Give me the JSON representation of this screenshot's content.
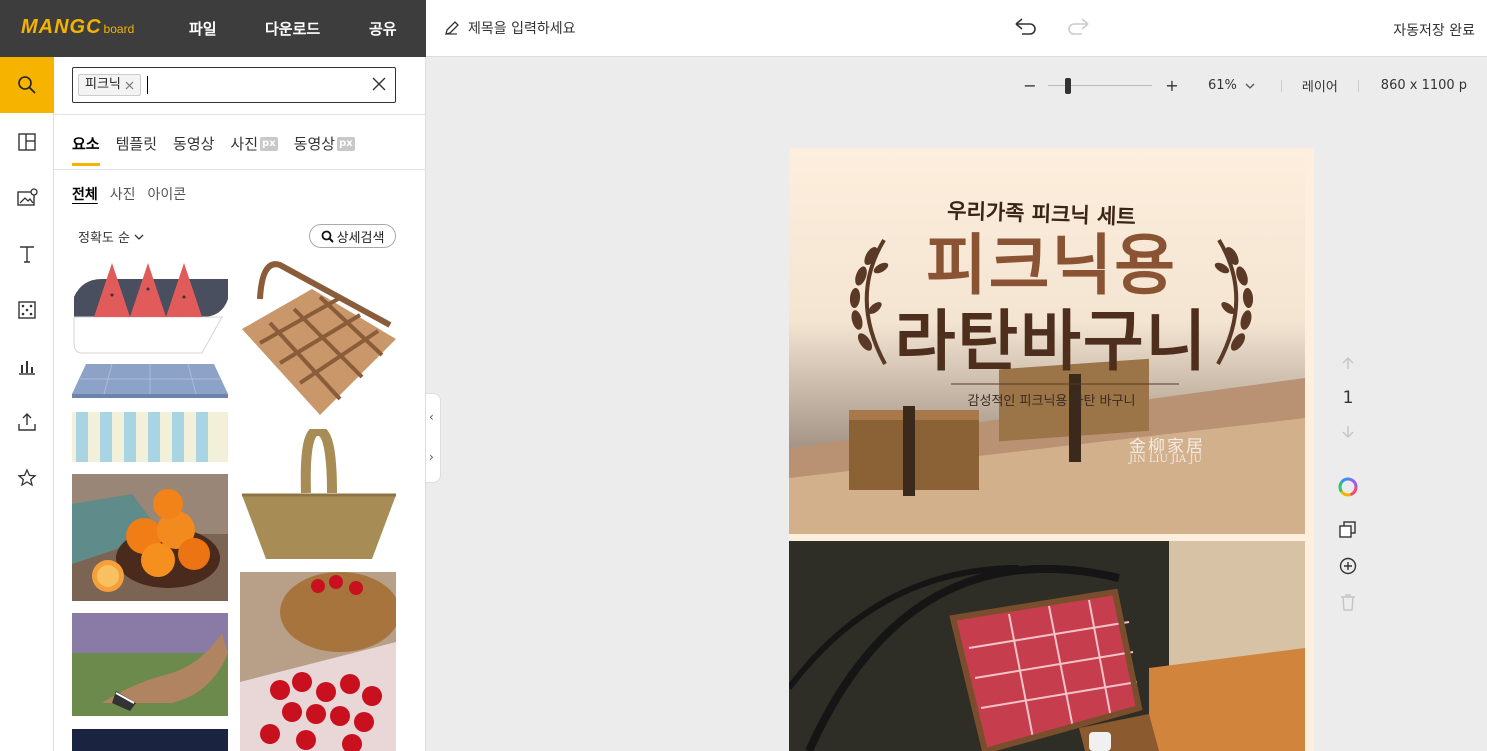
{
  "brand": {
    "logo_main": "MANGC",
    "logo_sub": "board"
  },
  "topmenu": [
    "파일",
    "다운로드",
    "공유"
  ],
  "document": {
    "title_placeholder": "제목을 입력하세요",
    "autosave": "자동저장 완료"
  },
  "search": {
    "chip": "피크닉"
  },
  "tabs": [
    {
      "label": "요소",
      "px": ""
    },
    {
      "label": "템플릿",
      "px": ""
    },
    {
      "label": "동영상",
      "px": ""
    },
    {
      "label": "사진",
      "px": "px"
    },
    {
      "label": "동영상",
      "px": "px"
    }
  ],
  "subtabs": [
    "전체",
    "사진",
    "아이콘"
  ],
  "sort": {
    "label": "정확도 순",
    "advanced": "상세검색"
  },
  "zoom": {
    "minus": "−",
    "plus": "+",
    "level": "61%",
    "level_value": 0.61,
    "layer": "레이어",
    "size": "860 x 1100 p"
  },
  "canvas": {
    "headline_small": "우리가족 피크닉 세트",
    "headline_1": "피크닉용",
    "headline_2": "라탄바구니",
    "caption": "감성적인 피크닉용 라탄 바구니",
    "watermark_1": "金柳家居",
    "watermark_2": "JIN LIU JIA JU"
  },
  "page_nav": {
    "number": "1"
  },
  "colors": {
    "accent": "#f6b400",
    "dark": "#3d3d3d",
    "headline": "#7a4a2c"
  }
}
